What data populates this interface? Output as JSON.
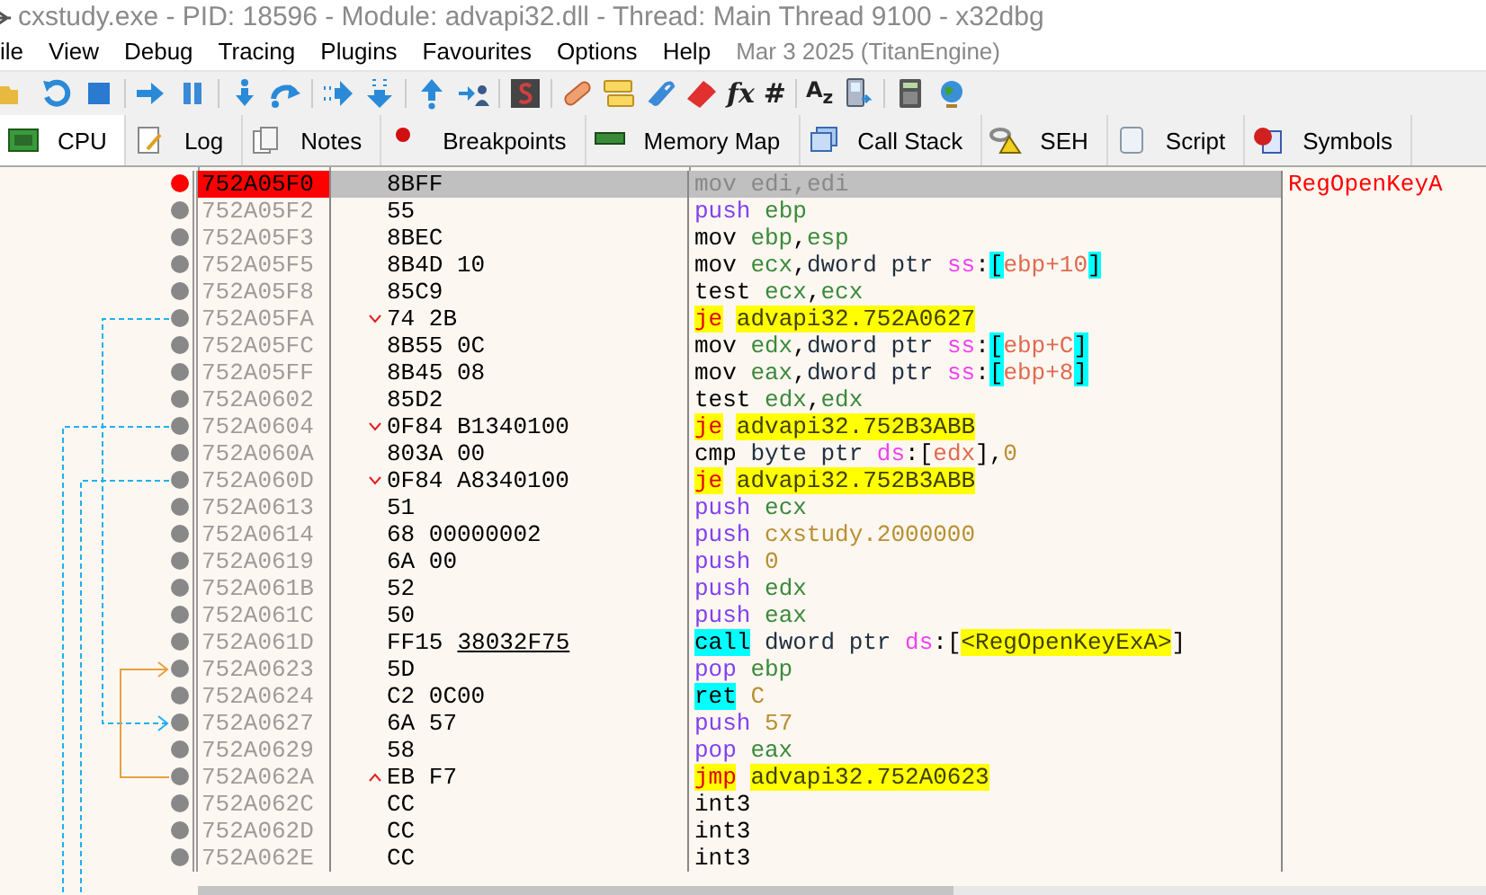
{
  "window": {
    "title": "cxstudy.exe - PID: 18596 - Module: advapi32.dll - Thread: Main Thread 9100 - x32dbg"
  },
  "menu": {
    "items": [
      "ile",
      "View",
      "Debug",
      "Tracing",
      "Plugins",
      "Favourites",
      "Options",
      "Help"
    ],
    "build_info": "Mar 3 2025 (TitanEngine)"
  },
  "toolbar": {
    "glyphs": [
      "fx",
      "#",
      "A$_{z}$"
    ]
  },
  "tabs": [
    {
      "label": "CPU",
      "selected": true
    },
    {
      "label": "Log",
      "selected": false
    },
    {
      "label": "Notes",
      "selected": false
    },
    {
      "label": "Breakpoints",
      "selected": false
    },
    {
      "label": "Memory Map",
      "selected": false
    },
    {
      "label": "Call Stack",
      "selected": false
    },
    {
      "label": "SEH",
      "selected": false
    },
    {
      "label": "Script",
      "selected": false
    },
    {
      "label": "Symbols",
      "selected": false
    }
  ],
  "disassembly": {
    "rows": [
      {
        "address": "752A05F0",
        "breakpoint": true,
        "selected": true,
        "bytes": "8BFF",
        "instruction": [
          {
            "text": "mov",
            "kind": "mnem"
          },
          {
            "text": " edi",
            "kind": "reg"
          },
          {
            "text": ",",
            "kind": "punct"
          },
          {
            "text": "edi",
            "kind": "reg"
          }
        ],
        "comment": "RegOpenKeyA"
      },
      {
        "address": "752A05F2",
        "breakpoint": false,
        "selected": false,
        "bytes": "55",
        "instruction": [
          {
            "text": "push",
            "kind": "stack"
          },
          {
            "text": " ebp",
            "kind": "reg"
          }
        ]
      },
      {
        "address": "752A05F3",
        "breakpoint": false,
        "selected": false,
        "bytes": "8BEC",
        "instruction": [
          {
            "text": "mov",
            "kind": "mnem"
          },
          {
            "text": " ebp",
            "kind": "reg"
          },
          {
            "text": ",",
            "kind": "punct"
          },
          {
            "text": "esp",
            "kind": "reg"
          }
        ]
      },
      {
        "address": "752A05F5",
        "breakpoint": false,
        "selected": false,
        "bytes": "8B4D 10",
        "instruction": [
          {
            "text": "mov",
            "kind": "mnem"
          },
          {
            "text": " ecx",
            "kind": "reg"
          },
          {
            "text": ",",
            "kind": "punct"
          },
          {
            "text": "dword ptr",
            "kind": "size"
          },
          {
            "text": " ss",
            "kind": "seg"
          },
          {
            "text": ":",
            "kind": "punct"
          },
          {
            "text": "[",
            "kind": "bracket"
          },
          {
            "text": "ebp+10",
            "kind": "mem"
          },
          {
            "text": "]",
            "kind": "bracket"
          }
        ]
      },
      {
        "address": "752A05F8",
        "breakpoint": false,
        "selected": false,
        "bytes": "85C9",
        "instruction": [
          {
            "text": "test",
            "kind": "mnem"
          },
          {
            "text": " ecx",
            "kind": "reg"
          },
          {
            "text": ",",
            "kind": "punct"
          },
          {
            "text": "ecx",
            "kind": "reg"
          }
        ]
      },
      {
        "address": "752A05FA",
        "breakpoint": false,
        "selected": false,
        "bytes": "74 2B",
        "kind": "jump",
        "instruction": [
          {
            "text": "je",
            "kind": "jump"
          },
          {
            "text": "advapi32.752A0627",
            "kind": "target"
          }
        ]
      },
      {
        "address": "752A05FC",
        "breakpoint": false,
        "selected": false,
        "bytes": "8B55 0C",
        "instruction": [
          {
            "text": "mov",
            "kind": "mnem"
          },
          {
            "text": " edx",
            "kind": "reg"
          },
          {
            "text": ",",
            "kind": "punct"
          },
          {
            "text": "dword ptr",
            "kind": "size"
          },
          {
            "text": " ss",
            "kind": "seg"
          },
          {
            "text": ":",
            "kind": "punct"
          },
          {
            "text": "[",
            "kind": "bracket"
          },
          {
            "text": "ebp+C",
            "kind": "mem"
          },
          {
            "text": "]",
            "kind": "bracket"
          }
        ]
      },
      {
        "address": "752A05FF",
        "breakpoint": false,
        "selected": false,
        "bytes": "8B45 08",
        "instruction": [
          {
            "text": "mov",
            "kind": "mnem"
          },
          {
            "text": " eax",
            "kind": "reg"
          },
          {
            "text": ",",
            "kind": "punct"
          },
          {
            "text": "dword ptr",
            "kind": "size"
          },
          {
            "text": " ss",
            "kind": "seg"
          },
          {
            "text": ":",
            "kind": "punct"
          },
          {
            "text": "[",
            "kind": "bracket"
          },
          {
            "text": "ebp+8",
            "kind": "mem"
          },
          {
            "text": "]",
            "kind": "bracket"
          }
        ]
      },
      {
        "address": "752A0602",
        "breakpoint": false,
        "selected": false,
        "bytes": "85D2",
        "instruction": [
          {
            "text": "test",
            "kind": "mnem"
          },
          {
            "text": " edx",
            "kind": "reg"
          },
          {
            "text": ",",
            "kind": "punct"
          },
          {
            "text": "edx",
            "kind": "reg"
          }
        ]
      },
      {
        "address": "752A0604",
        "breakpoint": false,
        "selected": false,
        "bytes": "0F84 B1340100",
        "kind": "jump",
        "instruction": [
          {
            "text": "je",
            "kind": "jump"
          },
          {
            "text": "advapi32.752B3ABB",
            "kind": "target"
          }
        ]
      },
      {
        "address": "752A060A",
        "breakpoint": false,
        "selected": false,
        "bytes": "803A 00",
        "instruction": [
          {
            "text": "cmp",
            "kind": "mnem"
          },
          {
            "text": " byte ptr",
            "kind": "size"
          },
          {
            "text": " ds",
            "kind": "seg"
          },
          {
            "text": ":[",
            "kind": "punct"
          },
          {
            "text": "edx",
            "kind": "mem"
          },
          {
            "text": "],",
            "kind": "punct"
          },
          {
            "text": "0",
            "kind": "num"
          }
        ]
      },
      {
        "address": "752A060D",
        "breakpoint": false,
        "selected": false,
        "bytes": "0F84 A8340100",
        "kind": "jump",
        "instruction": [
          {
            "text": "je",
            "kind": "jump"
          },
          {
            "text": "advapi32.752B3ABB",
            "kind": "target"
          }
        ]
      },
      {
        "address": "752A0613",
        "breakpoint": false,
        "selected": false,
        "bytes": "51",
        "instruction": [
          {
            "text": "push",
            "kind": "stack"
          },
          {
            "text": " ecx",
            "kind": "reg"
          }
        ]
      },
      {
        "address": "752A0614",
        "breakpoint": false,
        "selected": false,
        "bytes": "68 00000002",
        "instruction": [
          {
            "text": "push",
            "kind": "stack"
          },
          {
            "text": " cxstudy.2000000",
            "kind": "num"
          }
        ]
      },
      {
        "address": "752A0619",
        "breakpoint": false,
        "selected": false,
        "bytes": "6A 00",
        "instruction": [
          {
            "text": "push",
            "kind": "stack"
          },
          {
            "text": " 0",
            "kind": "num"
          }
        ]
      },
      {
        "address": "752A061B",
        "breakpoint": false,
        "selected": false,
        "bytes": "52",
        "instruction": [
          {
            "text": "push",
            "kind": "stack"
          },
          {
            "text": " edx",
            "kind": "reg"
          }
        ]
      },
      {
        "address": "752A061C",
        "breakpoint": false,
        "selected": false,
        "bytes": "50",
        "instruction": [
          {
            "text": "push",
            "kind": "stack"
          },
          {
            "text": " eax",
            "kind": "reg"
          }
        ]
      },
      {
        "address": "752A061D",
        "breakpoint": false,
        "selected": false,
        "bytes": "FF15",
        "bytes_ref": "38032F75",
        "instruction": [
          {
            "text": "call",
            "kind": "call"
          },
          {
            "text": " dword ptr",
            "kind": "size"
          },
          {
            "text": " ds",
            "kind": "seg"
          },
          {
            "text": ":[",
            "kind": "punct"
          },
          {
            "text": "<RegOpenKeyExA>",
            "kind": "target"
          },
          {
            "text": "]",
            "kind": "punct"
          }
        ]
      },
      {
        "address": "752A0623",
        "breakpoint": false,
        "selected": false,
        "bytes": "5D",
        "instruction": [
          {
            "text": "pop",
            "kind": "stack"
          },
          {
            "text": " ebp",
            "kind": "reg"
          }
        ]
      },
      {
        "address": "752A0624",
        "breakpoint": false,
        "selected": false,
        "bytes": "C2 0C00",
        "instruction": [
          {
            "text": "ret",
            "kind": "call"
          },
          {
            "text": " C",
            "kind": "num"
          }
        ]
      },
      {
        "address": "752A0627",
        "breakpoint": false,
        "selected": false,
        "bytes": "6A 57",
        "instruction": [
          {
            "text": "push",
            "kind": "stack"
          },
          {
            "text": " 57",
            "kind": "num"
          }
        ]
      },
      {
        "address": "752A0629",
        "breakpoint": false,
        "selected": false,
        "bytes": "58",
        "instruction": [
          {
            "text": "pop",
            "kind": "stack"
          },
          {
            "text": " eax",
            "kind": "reg"
          }
        ]
      },
      {
        "address": "752A062A",
        "breakpoint": false,
        "selected": false,
        "bytes": "EB F7",
        "kind": "jumpback",
        "instruction": [
          {
            "text": "jmp",
            "kind": "jump"
          },
          {
            "text": "advapi32.752A0623",
            "kind": "target"
          }
        ]
      },
      {
        "address": "752A062C",
        "breakpoint": false,
        "selected": false,
        "bytes": "CC",
        "instruction": [
          {
            "text": "int3",
            "kind": "mnem"
          }
        ]
      },
      {
        "address": "752A062D",
        "breakpoint": false,
        "selected": false,
        "bytes": "CC",
        "instruction": [
          {
            "text": "int3",
            "kind": "mnem"
          }
        ]
      },
      {
        "address": "752A062E",
        "breakpoint": false,
        "selected": false,
        "bytes": "CC",
        "instruction": [
          {
            "text": "int3",
            "kind": "mnem"
          }
        ]
      }
    ]
  }
}
